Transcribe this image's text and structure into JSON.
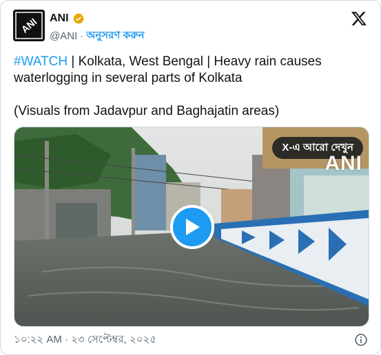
{
  "author": {
    "name": "ANI",
    "handle": "@ANI",
    "separator": "·",
    "follow_label": "অনুসরণ করুন",
    "avatar_text": "ANI",
    "verified_color": "#e6a700"
  },
  "tweet": {
    "hashtag": "#WATCH",
    "text_line1": " | Kolkata, West Bengal | Heavy rain causes waterlogging in several parts of Kolkata",
    "text_line2": "(Visuals from Jadavpur and Baghajatin areas)"
  },
  "media": {
    "watch_more_label": "X-এ আরো দেখুন",
    "watermark": "ANI",
    "play_color": "#1d9bf0"
  },
  "footer": {
    "timestamp": "১০:২২ AM · ২৩ সেপ্টেম্বর, ২০২৫"
  },
  "icons": {
    "platform": "x-logo-icon",
    "verified": "verified-badge-icon",
    "play": "play-icon",
    "info": "info-icon"
  },
  "colors": {
    "accent": "#1d9bf0",
    "text": "#0f1419",
    "muted": "#536471",
    "border": "#cfd9de"
  }
}
